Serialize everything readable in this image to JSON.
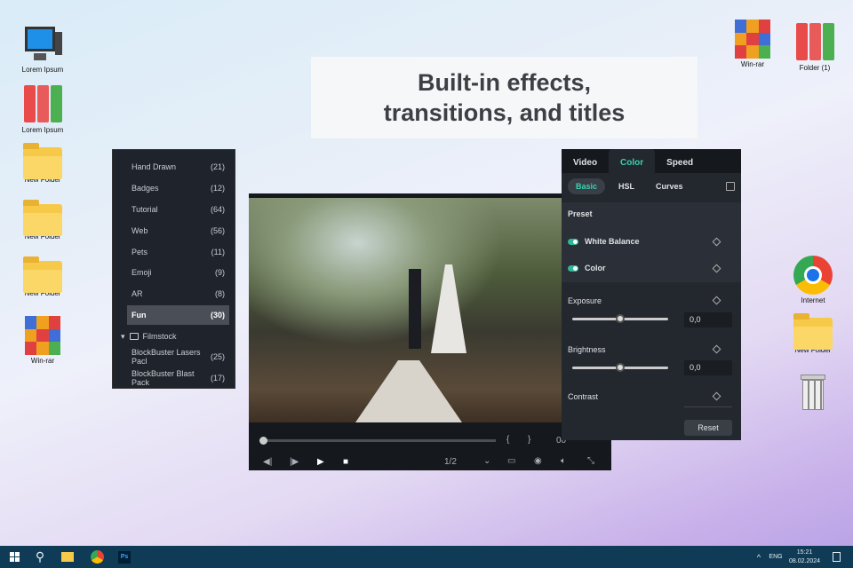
{
  "banner": {
    "line1": "Built-in effects,",
    "line2": "transitions, and titles"
  },
  "desktop": {
    "left": [
      {
        "label": "Lorem Ipsum",
        "icon": "monitor-icon"
      },
      {
        "label": "Lorem Ipsum",
        "icon": "binders-icon"
      },
      {
        "label": "New Folder",
        "icon": "folder-icon"
      },
      {
        "label": "New Folder",
        "icon": "folder-icon"
      },
      {
        "label": "New Folder",
        "icon": "folder-icon"
      },
      {
        "label": "Win-rar",
        "icon": "winrar-icon"
      }
    ],
    "right": [
      {
        "label": "Win-rar"
      },
      {
        "label": "Folder (1)"
      },
      {
        "label": "Internet"
      },
      {
        "label": "New Folder"
      }
    ]
  },
  "library": {
    "items": [
      {
        "name": "Hand Drawn",
        "count": "(21)"
      },
      {
        "name": "Badges",
        "count": "(12)"
      },
      {
        "name": "Tutorial",
        "count": "(64)"
      },
      {
        "name": "Web",
        "count": "(56)"
      },
      {
        "name": "Pets",
        "count": "(11)"
      },
      {
        "name": "Emoji",
        "count": "(9)"
      },
      {
        "name": "AR",
        "count": "(8)"
      },
      {
        "name": "Fun",
        "count": "(30)"
      }
    ],
    "folder": "Filmstock",
    "packs": [
      {
        "name": "BlockBuster Lasers Pacl",
        "count": "(25)"
      },
      {
        "name": "BlockBuster Blast Pack",
        "count": "(17)"
      }
    ]
  },
  "player": {
    "mark_in": "{",
    "mark_out": "}",
    "time": "00",
    "quality": "1/2"
  },
  "panel": {
    "tabs": [
      "Video",
      "Color",
      "Speed"
    ],
    "subtabs": [
      "Basic",
      "HSL",
      "Curves"
    ],
    "preset": "Preset",
    "toggles": [
      "White Balance",
      "Color"
    ],
    "exposure": "Exposure",
    "exposure_value": "0,0",
    "brightness": "Brightness",
    "brightness_value": "0,0",
    "contrast": "Contrast",
    "reset": "Reset",
    "accent": "#37d3b0"
  },
  "taskbar": {
    "lang": "ENG",
    "time": "15:21",
    "date": "08.02.2024"
  }
}
